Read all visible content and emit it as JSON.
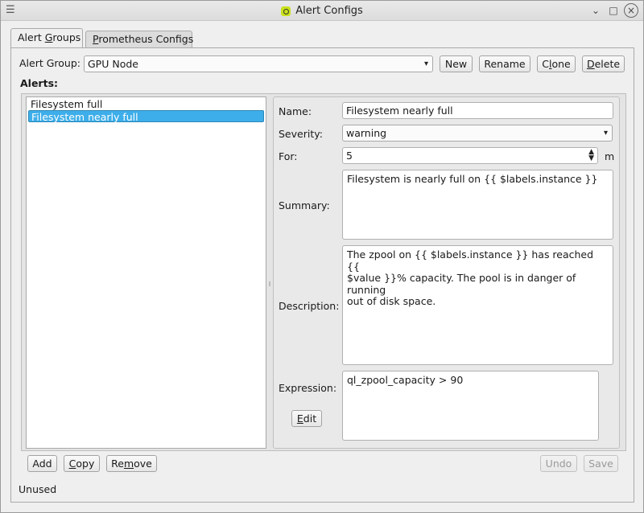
{
  "window": {
    "title": "Alert Configs"
  },
  "tabs": [
    {
      "label_prefix": "Alert ",
      "label_ul": "G",
      "label_suffix": "roups",
      "active": true
    },
    {
      "label_prefix": "",
      "label_ul": "P",
      "label_suffix": "rometheus Configs",
      "active": false
    }
  ],
  "alert_group": {
    "label": "Alert Group:",
    "selected": "GPU Node",
    "buttons": {
      "new": "New",
      "rename": "Rename",
      "clone_prefix": "C",
      "clone_ul": "l",
      "clone_suffix": "one",
      "delete_prefix": "",
      "delete_ul": "D",
      "delete_suffix": "elete"
    }
  },
  "alerts": {
    "label": "Alerts:",
    "items": [
      {
        "name": "Filesystem full",
        "selected": false
      },
      {
        "name": "Filesystem nearly full",
        "selected": true
      }
    ],
    "buttons": {
      "add": "Add",
      "copy_prefix": "",
      "copy_ul": "C",
      "copy_suffix": "opy",
      "remove_prefix": "Re",
      "remove_ul": "m",
      "remove_suffix": "ove"
    }
  },
  "detail": {
    "name_label": "Name:",
    "name_value": "Filesystem nearly full",
    "severity_label": "Severity:",
    "severity_value": "warning",
    "for_label": "For:",
    "for_value": "5",
    "for_unit": "m",
    "summary_label": "Summary:",
    "summary_value": "Filesystem is nearly full on {{ $labels.instance }}",
    "description_label": "Description:",
    "description_value": "The zpool on {{ $labels.instance }} has reached {{\n$value }}% capacity. The pool is in danger of running\nout of disk space.",
    "expression_label": "Expression:",
    "expression_value": "ql_zpool_capacity > 90",
    "edit_prefix": "",
    "edit_ul": "E",
    "edit_suffix": "dit"
  },
  "footer": {
    "undo": "Undo",
    "save": "Save",
    "status": "Unused"
  }
}
